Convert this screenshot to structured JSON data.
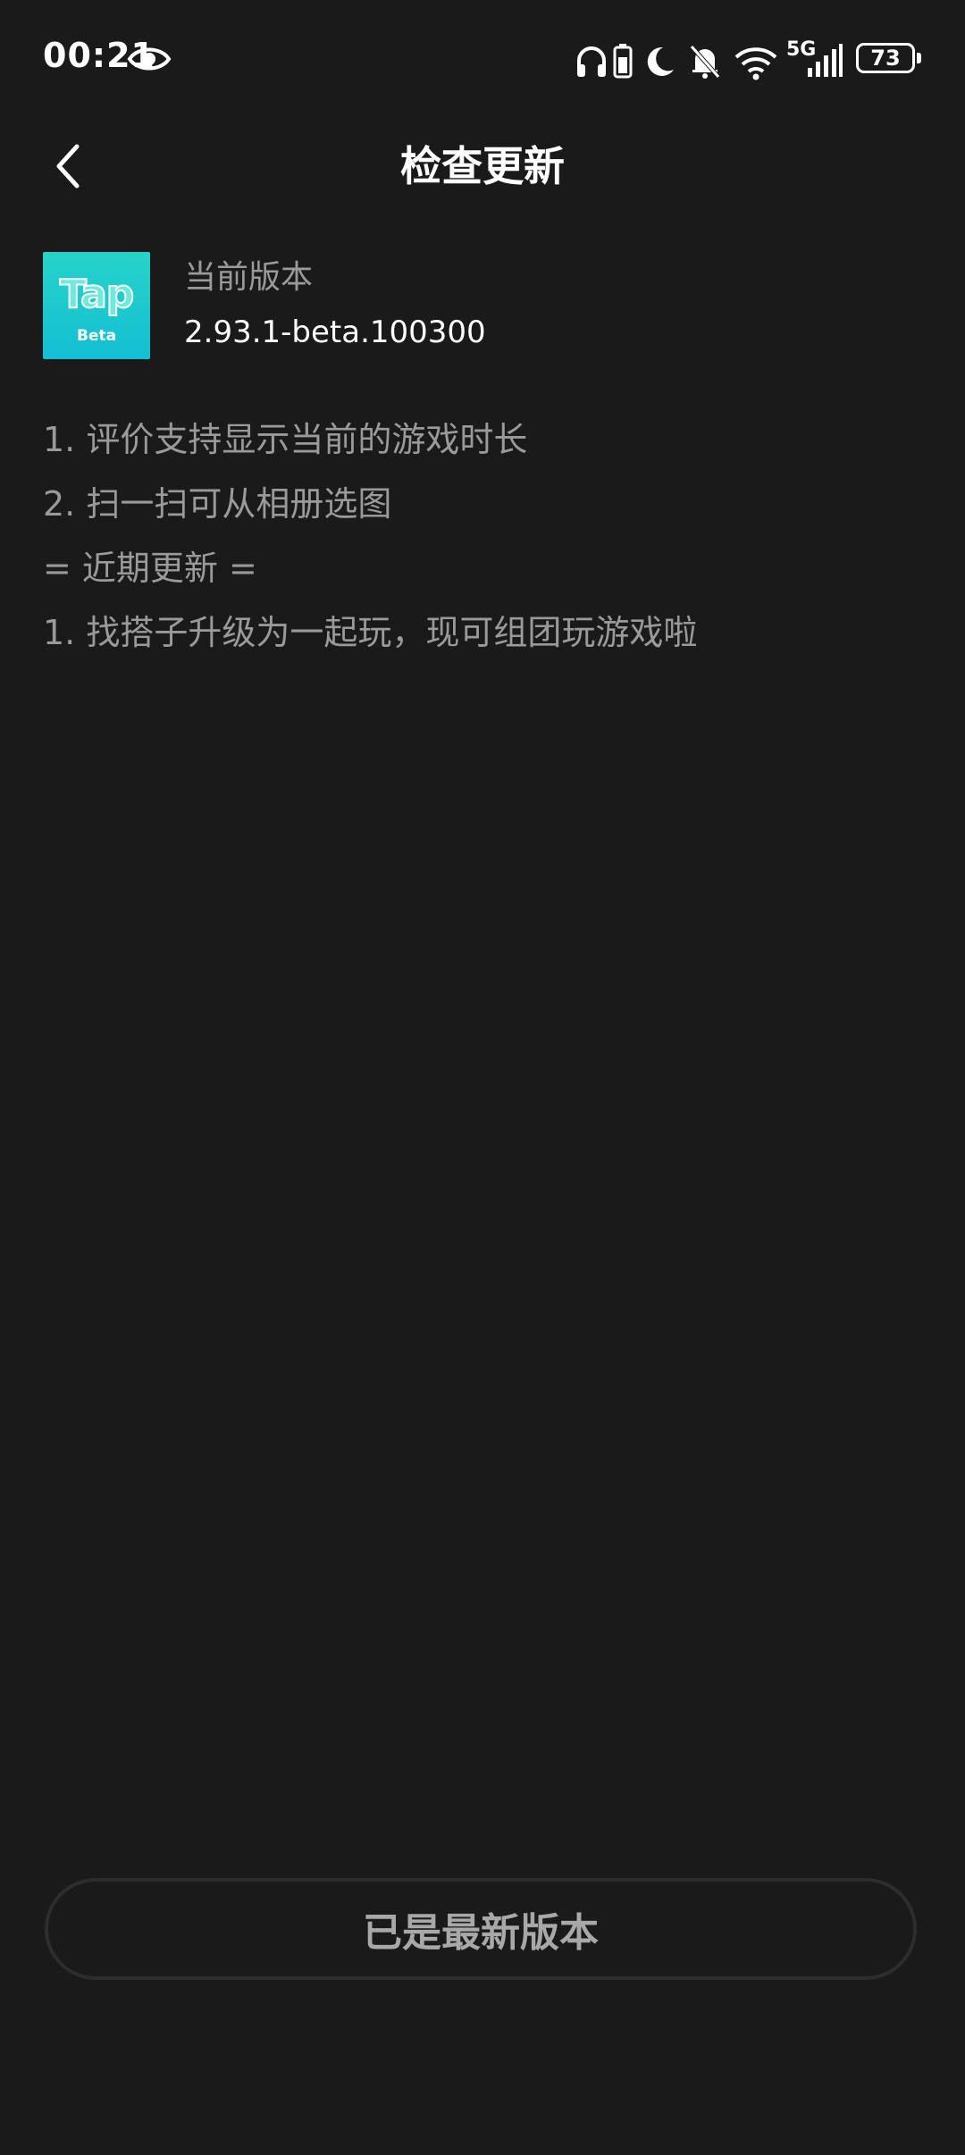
{
  "status_bar": {
    "time": "00:21",
    "network": "5G",
    "battery": "73"
  },
  "header": {
    "title": "检查更新"
  },
  "app": {
    "icon_text": "Tap",
    "icon_subtext": "Beta",
    "version_label": "当前版本",
    "version_value": "2.93.1-beta.100300"
  },
  "notes": [
    "1. 评价支持显示当前的游戏时长",
    "2. 扫一扫可从相册选图",
    "= 近期更新 =",
    "1. 找搭子升级为一起玩，现可组团玩游戏啦"
  ],
  "footer": {
    "button_label": "已是最新版本"
  },
  "colors": {
    "background": "#1a1a1a",
    "icon_gradient_start": "#27d3c9",
    "icon_gradient_end": "#13bfd3",
    "secondary_text": "#9a9a9a"
  },
  "icons": [
    "eye-icon",
    "headphones-icon",
    "battery-saver-icon",
    "moon-icon",
    "bell-off-icon",
    "wifi-icon",
    "signal-icon",
    "battery-icon",
    "back-arrow-icon"
  ]
}
